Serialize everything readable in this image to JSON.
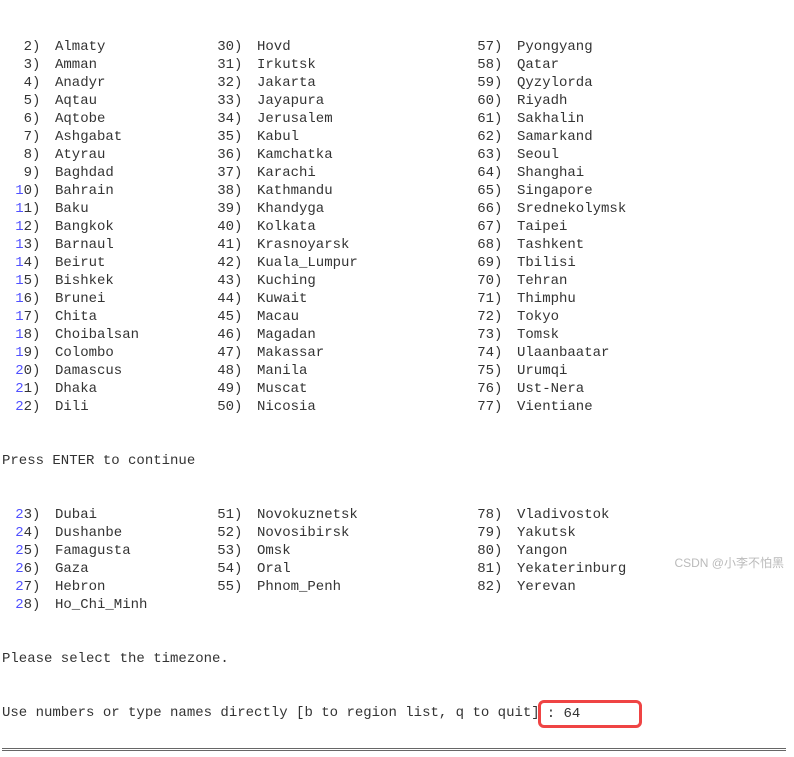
{
  "prompt_continue": "Press ENTER to continue",
  "prompt_select": "Please select the timezone.",
  "prompt_instruction": "Use numbers or type names directly [b to region list, q to quit]",
  "input_value": ": 64",
  "watermark": "CSDN @小李不怕黑",
  "columns": [
    {
      "start": 2,
      "items": [
        "Almaty",
        "Amman",
        "Anadyr",
        "Aqtau",
        "Aqtobe",
        "Ashgabat",
        "Atyrau",
        "Baghdad",
        "Bahrain",
        "Baku",
        "Bangkok",
        "Barnaul",
        "Beirut",
        "Bishkek",
        "Brunei",
        "Chita",
        "Choibalsan",
        "Colombo",
        "Damascus",
        "Dhaka",
        "Dili"
      ]
    },
    {
      "start": 30,
      "items": [
        "Hovd",
        "Irkutsk",
        "Jakarta",
        "Jayapura",
        "Jerusalem",
        "Kabul",
        "Kamchatka",
        "Karachi",
        "Kathmandu",
        "Khandyga",
        "Kolkata",
        "Krasnoyarsk",
        "Kuala_Lumpur",
        "Kuching",
        "Kuwait",
        "Macau",
        "Magadan",
        "Makassar",
        "Manila",
        "Muscat",
        "Nicosia"
      ]
    },
    {
      "start": 57,
      "items": [
        "Pyongyang",
        "Qatar",
        "Qyzylorda",
        "Riyadh",
        "Sakhalin",
        "Samarkand",
        "Seoul",
        "Shanghai",
        "Singapore",
        "Srednekolymsk",
        "Taipei",
        "Tashkent",
        "Tbilisi",
        "Tehran",
        "Thimphu",
        "Tokyo",
        "Tomsk",
        "Ulaanbaatar",
        "Urumqi",
        "Ust-Nera",
        "Vientiane"
      ]
    }
  ],
  "columns_after": [
    {
      "start": 23,
      "items": [
        "Dubai",
        "Dushanbe",
        "Famagusta",
        "Gaza",
        "Hebron",
        "Ho_Chi_Minh"
      ]
    },
    {
      "start": 51,
      "items": [
        "Novokuznetsk",
        "Novosibirsk",
        "Omsk",
        "Oral",
        "Phnom_Penh",
        ""
      ]
    },
    {
      "start": 78,
      "items": [
        "Vladivostok",
        "Yakutsk",
        "Yangon",
        "Yekaterinburg",
        "Yerevan",
        ""
      ]
    }
  ]
}
